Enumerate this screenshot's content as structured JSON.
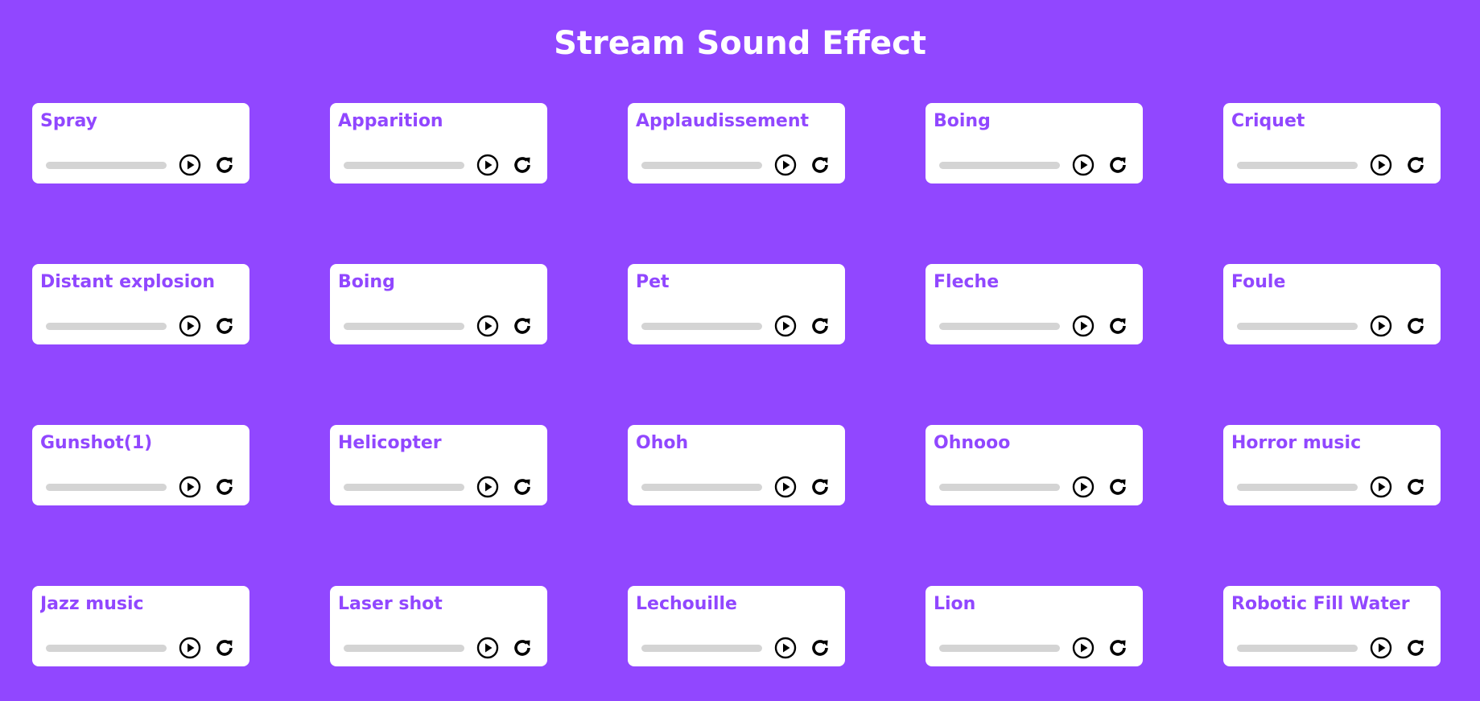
{
  "page": {
    "title": "Stream Sound Effect"
  },
  "colors": {
    "background": "#9147ff",
    "card": "#ffffff",
    "card_title": "#9147ff",
    "progress_track": "#d4d4d4",
    "icon": "#000000"
  },
  "icons": {
    "play": "play-circle-icon",
    "reload": "reload-icon"
  },
  "sounds": [
    {
      "name": "Spray",
      "progress": 0
    },
    {
      "name": "Apparition",
      "progress": 0
    },
    {
      "name": "Applaudissement",
      "progress": 0
    },
    {
      "name": "Boing",
      "progress": 0
    },
    {
      "name": "Criquet",
      "progress": 0
    },
    {
      "name": "Distant explosion",
      "progress": 0
    },
    {
      "name": "Boing",
      "progress": 0
    },
    {
      "name": "Pet",
      "progress": 0
    },
    {
      "name": "Fleche",
      "progress": 0
    },
    {
      "name": "Foule",
      "progress": 0
    },
    {
      "name": "Gunshot(1)",
      "progress": 0
    },
    {
      "name": "Helicopter",
      "progress": 0
    },
    {
      "name": "Ohoh",
      "progress": 0
    },
    {
      "name": "Ohnooo",
      "progress": 0
    },
    {
      "name": "Horror music",
      "progress": 0
    },
    {
      "name": "Jazz music",
      "progress": 0
    },
    {
      "name": "Laser shot",
      "progress": 0
    },
    {
      "name": "Lechouille",
      "progress": 0
    },
    {
      "name": "Lion",
      "progress": 0
    },
    {
      "name": "Robotic Fill Water",
      "progress": 0
    }
  ]
}
